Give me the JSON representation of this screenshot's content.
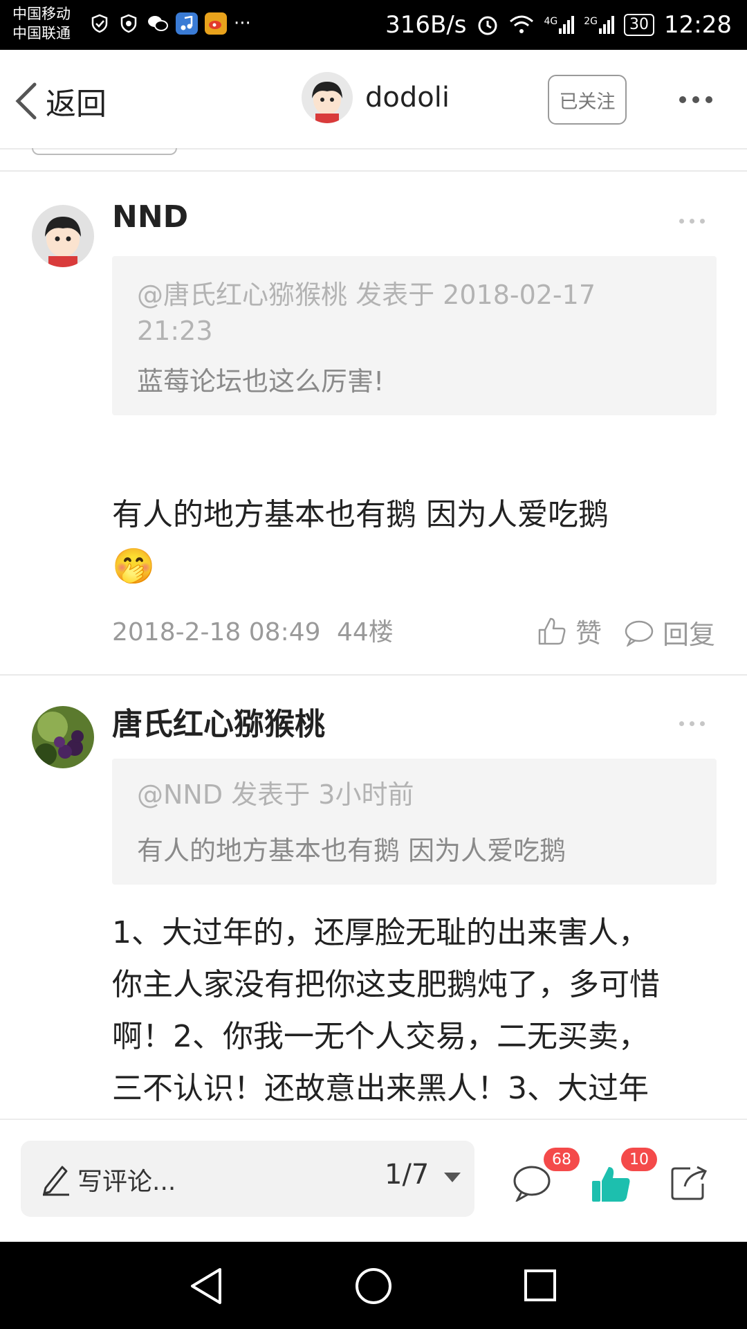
{
  "status_bar": {
    "carrier1": "中国移动",
    "carrier2": "中国联通",
    "overflow": "···",
    "net_speed": "316B/s",
    "net_4g": "4G",
    "net_2g": "2G",
    "battery": "30",
    "time": "12:28"
  },
  "nav": {
    "back_label": "返回",
    "username": "dodoli",
    "follow_label": "已关注"
  },
  "comments": [
    {
      "username": "NND",
      "quote_meta": "@唐氏红心猕猴桃 发表于 2018-02-17 21:23",
      "quote_text": "蓝莓论坛也这么厉害!",
      "body": "有人的地方基本也有鹅   因为人爱吃鹅",
      "emoji": "🤭",
      "date": "2018-2-18 08:49",
      "floor": "44楼",
      "like_label": "赞",
      "reply_label": "回复"
    },
    {
      "username": "唐氏红心猕猴桃",
      "quote_meta": "@NND 发表于 3小时前",
      "quote_text": "有人的地方基本也有鹅   因为人爱吃鹅",
      "body_lines": [
        "1、大过年的，还厚脸无耻的出来害人，",
        "你主人家没有把你这支肥鹅炖了，多可惜",
        "啊！2、你我一无个人交易，二无买卖，",
        "三不认识！还故意出来黑人！3、大过年"
      ]
    }
  ],
  "bottom": {
    "write_placeholder": "写评论...",
    "page_indicator": "1/7",
    "comment_count": "68",
    "like_count": "10",
    "accent": "#1dbfae"
  }
}
